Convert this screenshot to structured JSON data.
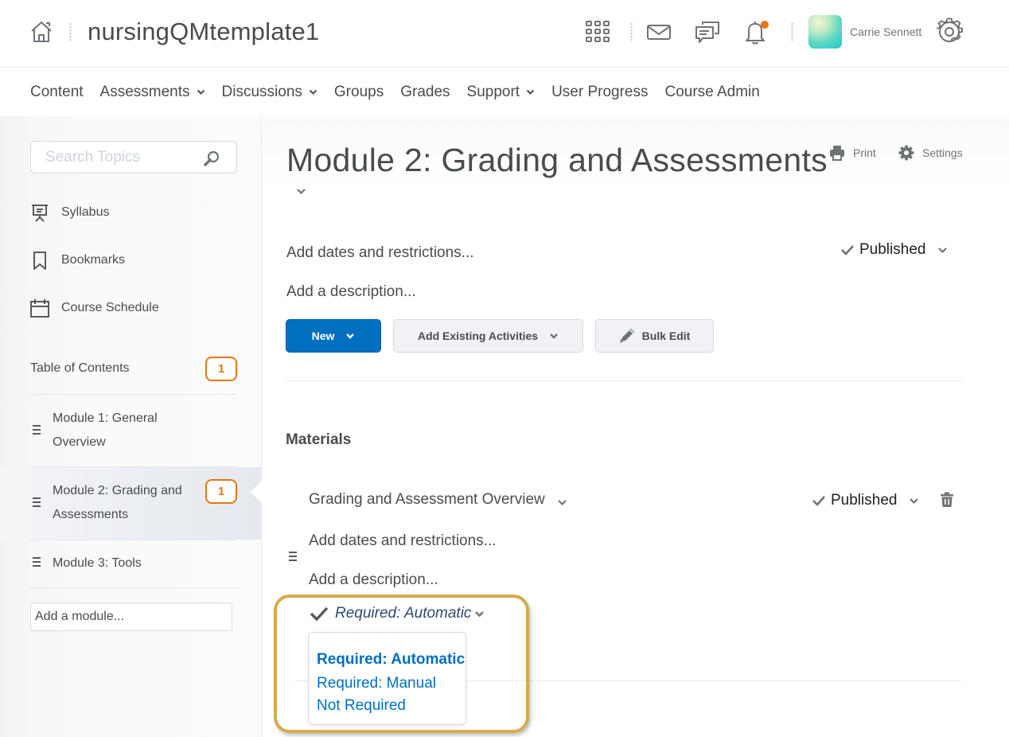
{
  "header": {
    "course_title": "nursingQMtemplate1",
    "user_name": "Carrie Sennett",
    "icons": [
      "home-icon",
      "waffle-grid-icon",
      "mail-icon",
      "chat-icon",
      "bell-icon",
      "avatar",
      "gear-icon"
    ],
    "notification_dot_color": "#e87511"
  },
  "nav": {
    "items": [
      {
        "label": "Content",
        "has_dropdown": false
      },
      {
        "label": "Assessments",
        "has_dropdown": true
      },
      {
        "label": "Discussions",
        "has_dropdown": true
      },
      {
        "label": "Groups",
        "has_dropdown": false
      },
      {
        "label": "Grades",
        "has_dropdown": false
      },
      {
        "label": "Support",
        "has_dropdown": true
      },
      {
        "label": "User Progress",
        "has_dropdown": false
      },
      {
        "label": "Course Admin",
        "has_dropdown": false
      }
    ]
  },
  "sidebar": {
    "search": {
      "placeholder": "Search Topics",
      "value": ""
    },
    "tools": [
      {
        "label": "Syllabus",
        "icon": "presentation-icon"
      },
      {
        "label": "Bookmarks",
        "icon": "bookmark-icon"
      },
      {
        "label": "Course Schedule",
        "icon": "calendar-icon"
      }
    ],
    "toc": {
      "label": "Table of Contents",
      "badge": "1"
    },
    "modules": [
      {
        "label": "Module 1: General Overview",
        "badge": null,
        "active": false
      },
      {
        "label": "Module 2: Grading and Assessments",
        "badge": "1",
        "active": true
      },
      {
        "label": "Module 3: Tools",
        "badge": null,
        "active": false
      }
    ],
    "add_module": {
      "placeholder": "Add a module...",
      "value": ""
    }
  },
  "main": {
    "title": "Module 2: Grading and Assessments",
    "print_label": "Print",
    "settings_label": "Settings",
    "add_dates": "Add dates and restrictions...",
    "add_description": "Add a description...",
    "status": "Published",
    "buttons": {
      "new": "New",
      "add_existing": "Add Existing Activities",
      "bulk_edit": "Bulk Edit"
    },
    "section_title": "Materials",
    "topic": {
      "title": "Grading and Assessment Overview",
      "status": "Published",
      "add_dates": "Add dates and restrictions...",
      "add_description": "Add a description...",
      "completion": {
        "current": "Required: Automatic",
        "options": [
          {
            "label": "Required: Automatic",
            "selected": true
          },
          {
            "label": "Required: Manual",
            "selected": false
          },
          {
            "label": "Not Required",
            "selected": false
          }
        ]
      }
    }
  },
  "colors": {
    "primary": "#006fbf",
    "badge_orange": "#e87511",
    "highlight_gold": "#d6aa4d",
    "text": "#494c4e"
  }
}
